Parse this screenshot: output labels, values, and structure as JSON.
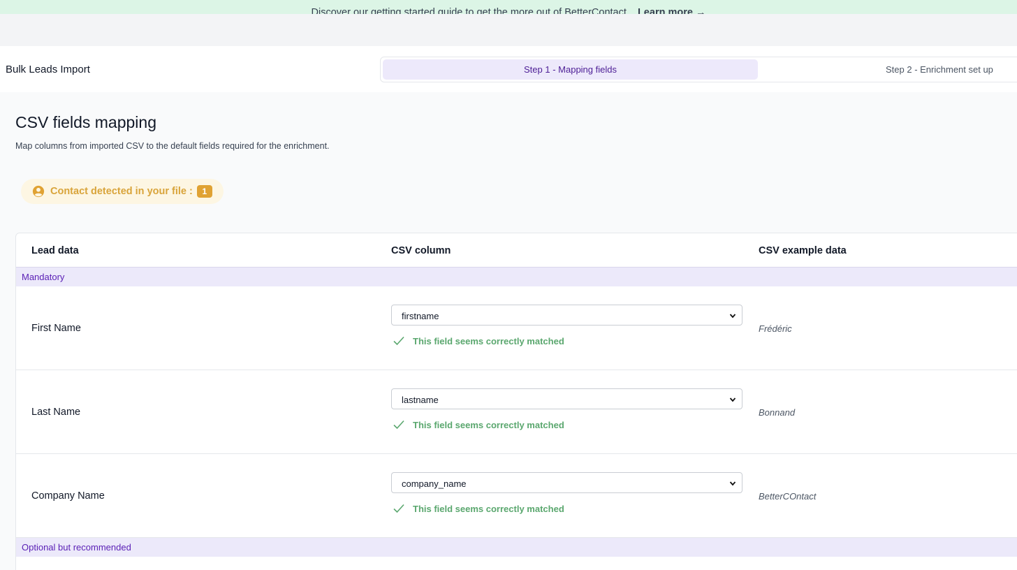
{
  "banner": {
    "text": "Discover our getting started guide to get the more out of BetterContact.",
    "link_label": "Learn more →"
  },
  "header": {
    "app_title": "Bulk Leads Import",
    "steps": [
      {
        "label": "Step 1 - Mapping fields",
        "active": true
      },
      {
        "label": "Step 2 - Enrichment set up",
        "active": false
      }
    ]
  },
  "main": {
    "title": "CSV fields mapping",
    "subtitle": "Map columns from imported CSV to the default fields required for the enrichment.",
    "contact_detected": {
      "label": "Contact detected in your file :",
      "count": "1"
    }
  },
  "table": {
    "columns": [
      "Lead data",
      "CSV column",
      "CSV example data"
    ],
    "groups": [
      {
        "label": "Mandatory",
        "rows": [
          {
            "lead_field": "First Name",
            "csv_column": "firstname",
            "status": "This field seems correctly matched",
            "example": "Frédéric"
          },
          {
            "lead_field": "Last Name",
            "csv_column": "lastname",
            "status": "This field seems correctly matched",
            "example": "Bonnand"
          },
          {
            "lead_field": "Company Name",
            "csv_column": "company_name",
            "status": "This field seems correctly matched",
            "example": "BetterCOntact"
          }
        ]
      },
      {
        "label": "Optional but recommended",
        "rows": []
      }
    ]
  },
  "colors": {
    "accent": "#5b21b6",
    "success": "#5aa76e",
    "warning": "#e0a233",
    "banner_bg": "#dcf5e6"
  },
  "icons": {
    "contact": "person-circle-icon",
    "match": "check-icon",
    "select": "chevron-down-icon"
  }
}
